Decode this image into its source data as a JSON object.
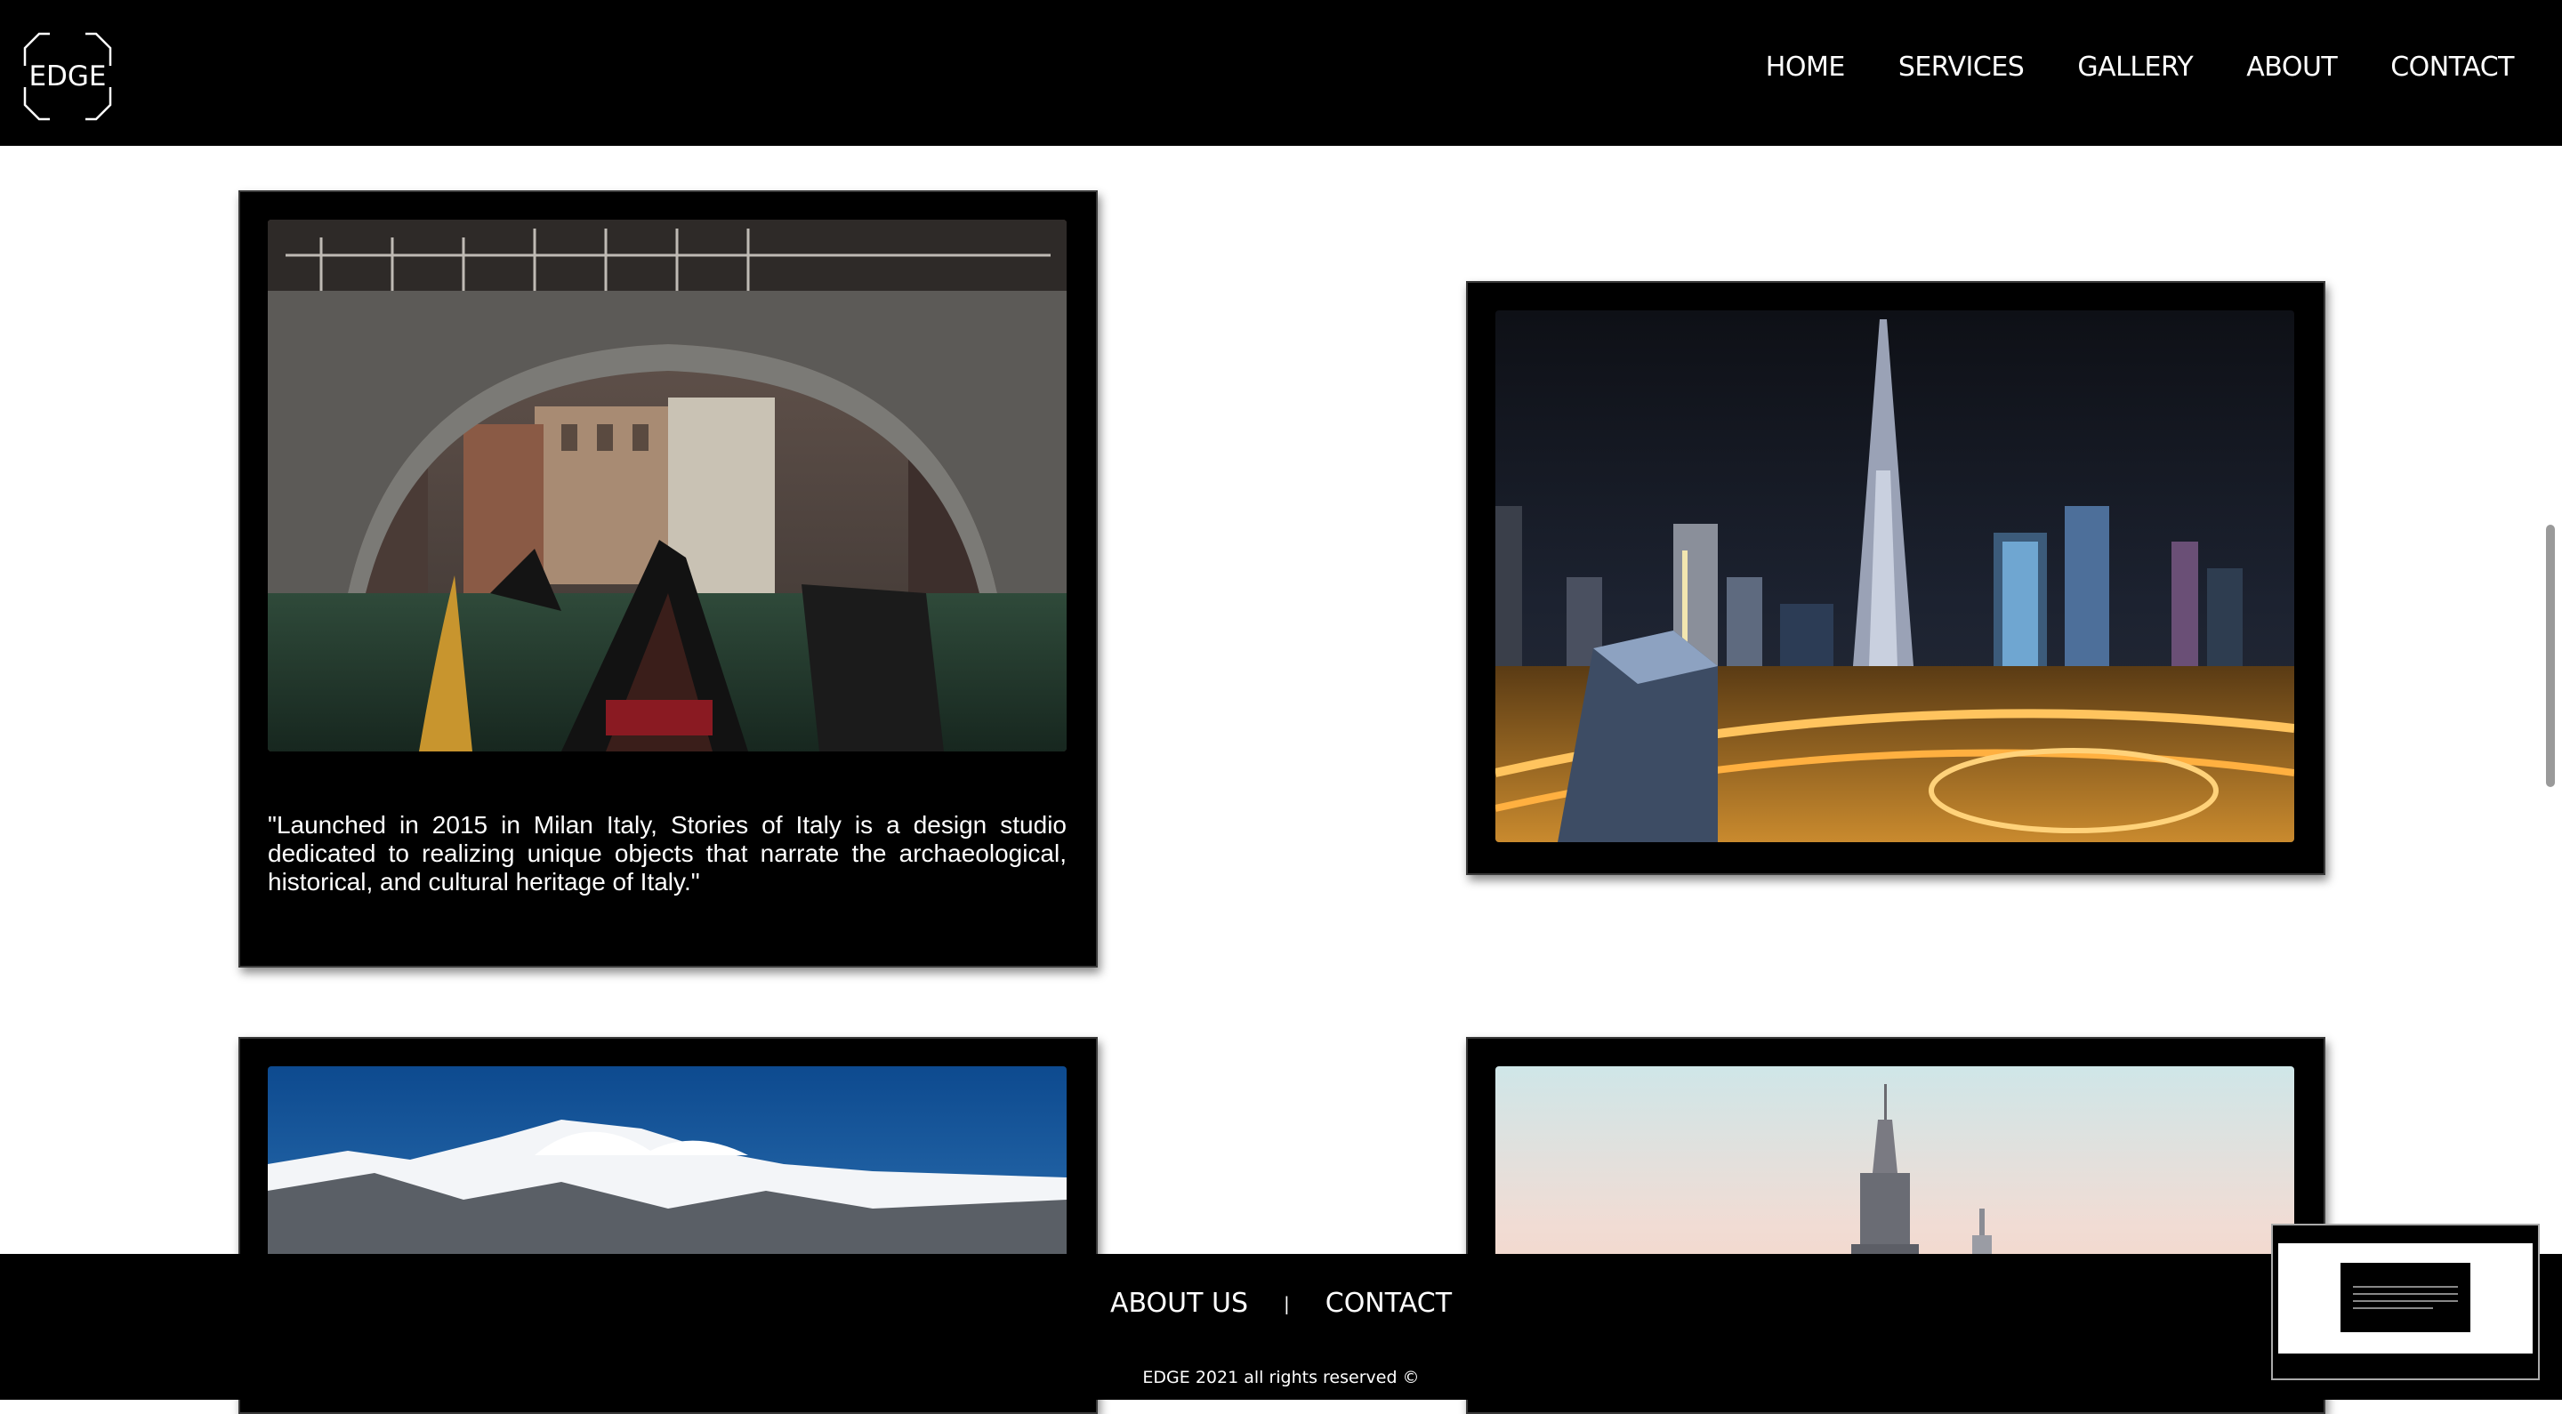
{
  "header": {
    "logo_text": "EDGE",
    "nav": [
      "HOME",
      "SERVICES",
      "GALLERY",
      "ABOUT",
      "CONTACT"
    ]
  },
  "gallery": {
    "cards": [
      {
        "image": "venice-gondola-bridge-photo",
        "caption": "\"Launched in 2015 in Milan Italy, Stories of Italy is a design studio dedicated to realizing unique objects that narrate the archaeological, historical, and cultural heritage of Italy.\""
      },
      {
        "image": "dubai-night-skyline-photo",
        "caption": ""
      },
      {
        "image": "snowy-mountains-photo",
        "caption": ""
      },
      {
        "image": "empire-state-building-dusk-photo",
        "caption": ""
      }
    ]
  },
  "footer": {
    "about_label": "ABOUT US",
    "separator": "|",
    "contact_label": "CONTACT",
    "copyright": "EDGE 2021 all rights reserved ©"
  },
  "colors": {
    "header_bg": "#000000",
    "card_bg": "#000000",
    "page_bg": "#ffffff"
  }
}
